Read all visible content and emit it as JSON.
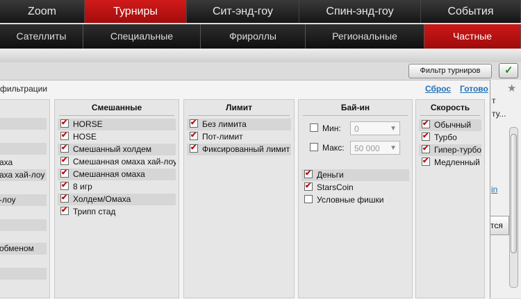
{
  "top_tabs": [
    "Zoom",
    "Турниры",
    "Сит-энд-гоу",
    "Спин-энд-гоу",
    "События"
  ],
  "sub_tabs": [
    "Сателлиты",
    "Специальные",
    "Фрироллы",
    "Региональные",
    "Частные"
  ],
  "filter_button": "Фильтр турниров",
  "panel": {
    "title": "фильтрации",
    "reset": "Сброс",
    "done": "Готово"
  },
  "left_col": [
    "",
    "",
    "",
    "аха",
    "аха хай-лоу",
    "",
    "-лоу",
    "",
    "",
    "",
    "обменом",
    "",
    ""
  ],
  "mixed": {
    "header": "Смешанные",
    "items": [
      "HORSE",
      "HOSE",
      "Смешанный холдем",
      "Смешанная омаха хай-лоу",
      "Смешанная омаха",
      "8 игр",
      "Холдем/Омаха",
      "Трипп стад"
    ]
  },
  "limit": {
    "header": "Лимит",
    "items": [
      "Без лимита",
      "Пот-лимит",
      "Фиксированный лимит"
    ]
  },
  "buyin": {
    "header": "Бай-ин",
    "min_label": "Мин:",
    "min_value": "0",
    "max_label": "Макс:",
    "max_value": "50 000",
    "items": [
      "Деньги",
      "StarsCoin",
      "Условные фишки"
    ]
  },
  "speed": {
    "header": "Скорость",
    "items": [
      "Обычный",
      "Турбо",
      "Гипер-турбо",
      "Медленный"
    ]
  },
  "right": {
    "text1": "т",
    "text2": "ту...",
    "link": "in",
    "text3": "тся"
  }
}
